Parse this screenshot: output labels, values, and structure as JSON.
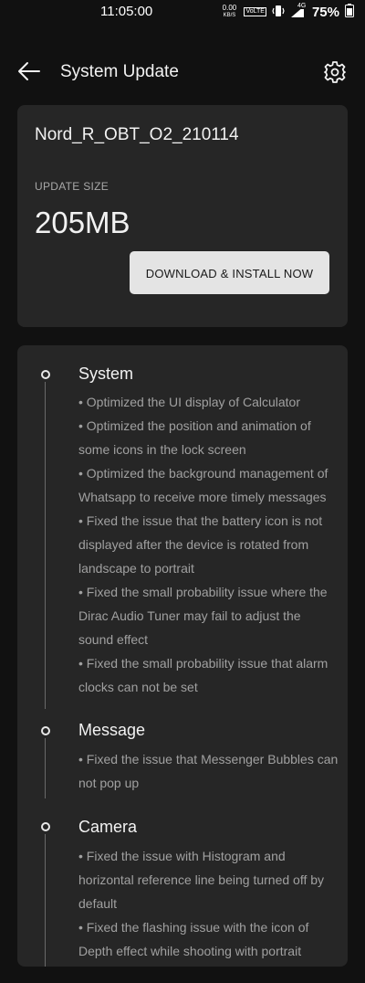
{
  "status_bar": {
    "time": "11:05:00",
    "net_speed_value": "0.00",
    "net_speed_unit": "KB/S",
    "volte": "VoLTE",
    "network": "4G",
    "battery": "75%"
  },
  "header": {
    "title": "System Update",
    "back_icon": "arrow-left-icon",
    "settings_icon": "gear-icon"
  },
  "update": {
    "version": "Nord_R_OBT_O2_210114",
    "size_label": "UPDATE SIZE",
    "size_value": "205MB",
    "button_label": "DOWNLOAD & INSTALL NOW"
  },
  "changelog": {
    "sections": [
      {
        "title": "System",
        "items": [
          "• Optimized the UI display of Calculator",
          "• Optimized the position and animation of some icons in the lock screen",
          "• Optimized the background management of Whatsapp to receive more timely messages",
          "• Fixed the issue that the battery icon is not displayed after the device is rotated from landscape to portrait",
          "• Fixed the small probability issue where the Dirac Audio Tuner may fail to adjust the sound effect",
          "• Fixed the small probability issue that alarm clocks can not be set"
        ]
      },
      {
        "title": "Message",
        "items": [
          "• Fixed the issue that Messenger Bubbles can not pop up"
        ]
      },
      {
        "title": "Camera",
        "items": [
          "• Fixed the issue with Histogram and horizontal reference line being turned off by default",
          "• Fixed the flashing issue with the icon of Depth effect while shooting with portrait"
        ]
      }
    ]
  }
}
